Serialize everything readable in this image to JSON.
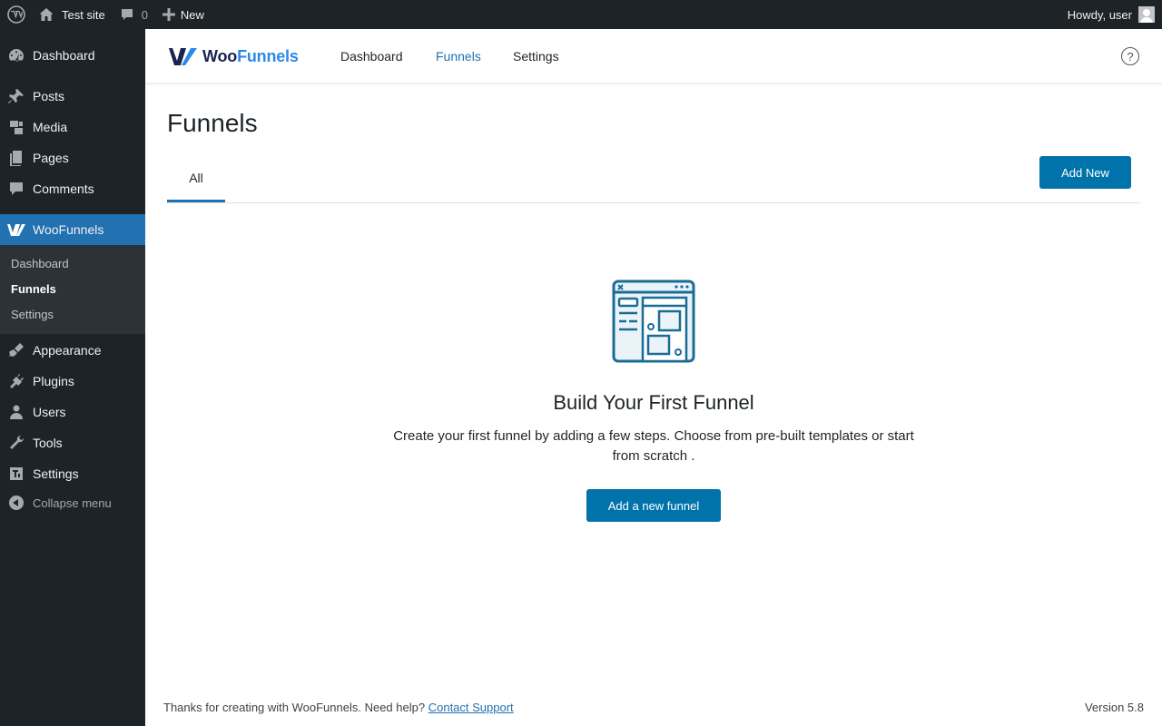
{
  "admin_bar": {
    "site_name": "Test site",
    "comments_count": "0",
    "new_label": "New",
    "greeting": "Howdy, user"
  },
  "sidebar": {
    "items": [
      {
        "label": "Dashboard",
        "icon": "dashboard-icon"
      },
      {
        "label": "Posts",
        "icon": "pushpin-icon"
      },
      {
        "label": "Media",
        "icon": "media-icon"
      },
      {
        "label": "Pages",
        "icon": "pages-icon"
      },
      {
        "label": "Comments",
        "icon": "comment-icon"
      },
      {
        "label": "WooFunnels",
        "icon": "woofunnels-icon"
      },
      {
        "label": "Appearance",
        "icon": "brush-icon"
      },
      {
        "label": "Plugins",
        "icon": "plugin-icon"
      },
      {
        "label": "Users",
        "icon": "user-icon"
      },
      {
        "label": "Tools",
        "icon": "wrench-icon"
      },
      {
        "label": "Settings",
        "icon": "settings-icon"
      }
    ],
    "submenu": [
      "Dashboard",
      "Funnels",
      "Settings"
    ],
    "collapse_label": "Collapse menu"
  },
  "plugin_header": {
    "logo_woo": "Woo",
    "logo_funnels": "Funnels",
    "nav": [
      "Dashboard",
      "Funnels",
      "Settings"
    ],
    "active_nav": "Funnels",
    "help_symbol": "?"
  },
  "main": {
    "title": "Funnels",
    "tab_all": "All",
    "add_new_label": "Add New",
    "empty_title": "Build Your First Funnel",
    "empty_desc": "Create your first funnel by adding a few steps. Choose from pre-built templates or start from scratch .",
    "add_funnel_label": "Add a new funnel"
  },
  "footer": {
    "text": "Thanks for creating with WooFunnels. Need help?",
    "link": "Contact Support",
    "version": "Version 5.8"
  },
  "colors": {
    "admin_dark": "#1d2327",
    "accent": "#2271b1",
    "button": "#0073aa"
  }
}
